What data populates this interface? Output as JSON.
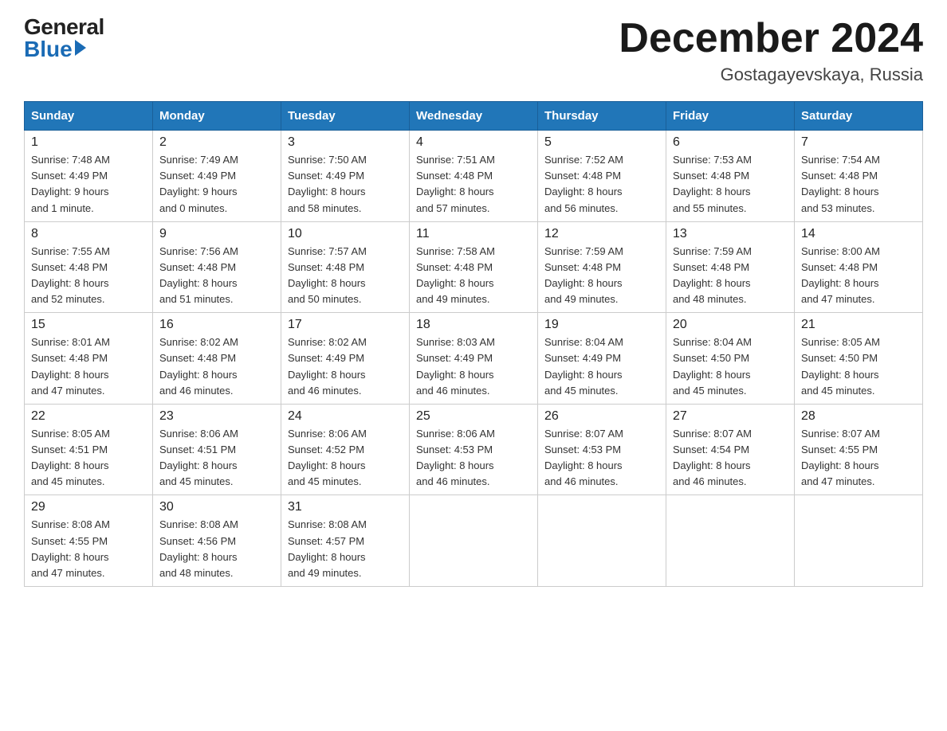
{
  "logo": {
    "general": "General",
    "blue": "Blue"
  },
  "title": "December 2024",
  "location": "Gostagayevskaya, Russia",
  "headers": [
    "Sunday",
    "Monday",
    "Tuesday",
    "Wednesday",
    "Thursday",
    "Friday",
    "Saturday"
  ],
  "weeks": [
    [
      {
        "day": "1",
        "info": "Sunrise: 7:48 AM\nSunset: 4:49 PM\nDaylight: 9 hours\nand 1 minute."
      },
      {
        "day": "2",
        "info": "Sunrise: 7:49 AM\nSunset: 4:49 PM\nDaylight: 9 hours\nand 0 minutes."
      },
      {
        "day": "3",
        "info": "Sunrise: 7:50 AM\nSunset: 4:49 PM\nDaylight: 8 hours\nand 58 minutes."
      },
      {
        "day": "4",
        "info": "Sunrise: 7:51 AM\nSunset: 4:48 PM\nDaylight: 8 hours\nand 57 minutes."
      },
      {
        "day": "5",
        "info": "Sunrise: 7:52 AM\nSunset: 4:48 PM\nDaylight: 8 hours\nand 56 minutes."
      },
      {
        "day": "6",
        "info": "Sunrise: 7:53 AM\nSunset: 4:48 PM\nDaylight: 8 hours\nand 55 minutes."
      },
      {
        "day": "7",
        "info": "Sunrise: 7:54 AM\nSunset: 4:48 PM\nDaylight: 8 hours\nand 53 minutes."
      }
    ],
    [
      {
        "day": "8",
        "info": "Sunrise: 7:55 AM\nSunset: 4:48 PM\nDaylight: 8 hours\nand 52 minutes."
      },
      {
        "day": "9",
        "info": "Sunrise: 7:56 AM\nSunset: 4:48 PM\nDaylight: 8 hours\nand 51 minutes."
      },
      {
        "day": "10",
        "info": "Sunrise: 7:57 AM\nSunset: 4:48 PM\nDaylight: 8 hours\nand 50 minutes."
      },
      {
        "day": "11",
        "info": "Sunrise: 7:58 AM\nSunset: 4:48 PM\nDaylight: 8 hours\nand 49 minutes."
      },
      {
        "day": "12",
        "info": "Sunrise: 7:59 AM\nSunset: 4:48 PM\nDaylight: 8 hours\nand 49 minutes."
      },
      {
        "day": "13",
        "info": "Sunrise: 7:59 AM\nSunset: 4:48 PM\nDaylight: 8 hours\nand 48 minutes."
      },
      {
        "day": "14",
        "info": "Sunrise: 8:00 AM\nSunset: 4:48 PM\nDaylight: 8 hours\nand 47 minutes."
      }
    ],
    [
      {
        "day": "15",
        "info": "Sunrise: 8:01 AM\nSunset: 4:48 PM\nDaylight: 8 hours\nand 47 minutes."
      },
      {
        "day": "16",
        "info": "Sunrise: 8:02 AM\nSunset: 4:48 PM\nDaylight: 8 hours\nand 46 minutes."
      },
      {
        "day": "17",
        "info": "Sunrise: 8:02 AM\nSunset: 4:49 PM\nDaylight: 8 hours\nand 46 minutes."
      },
      {
        "day": "18",
        "info": "Sunrise: 8:03 AM\nSunset: 4:49 PM\nDaylight: 8 hours\nand 46 minutes."
      },
      {
        "day": "19",
        "info": "Sunrise: 8:04 AM\nSunset: 4:49 PM\nDaylight: 8 hours\nand 45 minutes."
      },
      {
        "day": "20",
        "info": "Sunrise: 8:04 AM\nSunset: 4:50 PM\nDaylight: 8 hours\nand 45 minutes."
      },
      {
        "day": "21",
        "info": "Sunrise: 8:05 AM\nSunset: 4:50 PM\nDaylight: 8 hours\nand 45 minutes."
      }
    ],
    [
      {
        "day": "22",
        "info": "Sunrise: 8:05 AM\nSunset: 4:51 PM\nDaylight: 8 hours\nand 45 minutes."
      },
      {
        "day": "23",
        "info": "Sunrise: 8:06 AM\nSunset: 4:51 PM\nDaylight: 8 hours\nand 45 minutes."
      },
      {
        "day": "24",
        "info": "Sunrise: 8:06 AM\nSunset: 4:52 PM\nDaylight: 8 hours\nand 45 minutes."
      },
      {
        "day": "25",
        "info": "Sunrise: 8:06 AM\nSunset: 4:53 PM\nDaylight: 8 hours\nand 46 minutes."
      },
      {
        "day": "26",
        "info": "Sunrise: 8:07 AM\nSunset: 4:53 PM\nDaylight: 8 hours\nand 46 minutes."
      },
      {
        "day": "27",
        "info": "Sunrise: 8:07 AM\nSunset: 4:54 PM\nDaylight: 8 hours\nand 46 minutes."
      },
      {
        "day": "28",
        "info": "Sunrise: 8:07 AM\nSunset: 4:55 PM\nDaylight: 8 hours\nand 47 minutes."
      }
    ],
    [
      {
        "day": "29",
        "info": "Sunrise: 8:08 AM\nSunset: 4:55 PM\nDaylight: 8 hours\nand 47 minutes."
      },
      {
        "day": "30",
        "info": "Sunrise: 8:08 AM\nSunset: 4:56 PM\nDaylight: 8 hours\nand 48 minutes."
      },
      {
        "day": "31",
        "info": "Sunrise: 8:08 AM\nSunset: 4:57 PM\nDaylight: 8 hours\nand 49 minutes."
      },
      {
        "day": "",
        "info": ""
      },
      {
        "day": "",
        "info": ""
      },
      {
        "day": "",
        "info": ""
      },
      {
        "day": "",
        "info": ""
      }
    ]
  ]
}
